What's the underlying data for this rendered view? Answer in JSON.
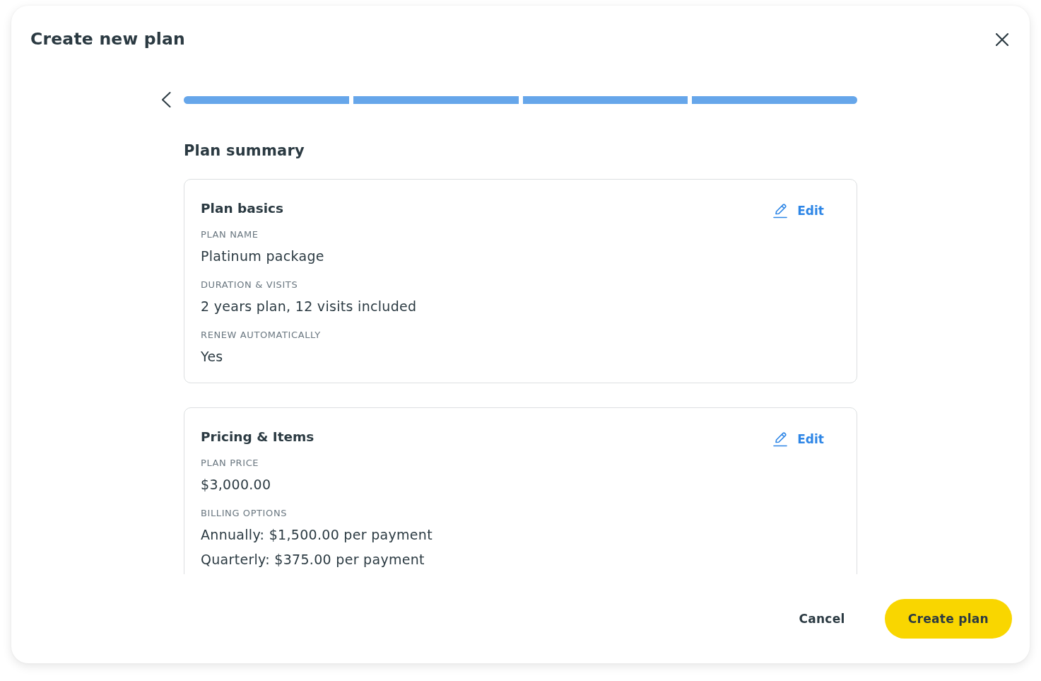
{
  "dialog": {
    "title": "Create new plan"
  },
  "progress": {
    "steps": [
      {
        "completed": true
      },
      {
        "completed": true
      },
      {
        "completed": true
      },
      {
        "completed": true
      }
    ]
  },
  "summary": {
    "heading": "Plan summary",
    "sections": [
      {
        "title": "Plan basics",
        "edit_label": "Edit",
        "fields": [
          {
            "label": "PLAN NAME",
            "values": [
              "Platinum package"
            ]
          },
          {
            "label": "DURATION & VISITS",
            "values": [
              "2 years plan, 12 visits included"
            ]
          },
          {
            "label": "RENEW AUTOMATICALLY",
            "values": [
              "Yes"
            ]
          }
        ]
      },
      {
        "title": "Pricing & Items",
        "edit_label": "Edit",
        "fields": [
          {
            "label": "PLAN PRICE",
            "values": [
              "$3,000.00"
            ]
          },
          {
            "label": "BILLING OPTIONS",
            "values": [
              "Annually: $1,500.00 per payment",
              "Quarterly: $375.00 per payment"
            ]
          }
        ]
      }
    ]
  },
  "footer": {
    "buttons": [
      {
        "label": "Cancel",
        "kind": "text"
      },
      {
        "label": "Create plan",
        "kind": "primary"
      }
    ]
  }
}
